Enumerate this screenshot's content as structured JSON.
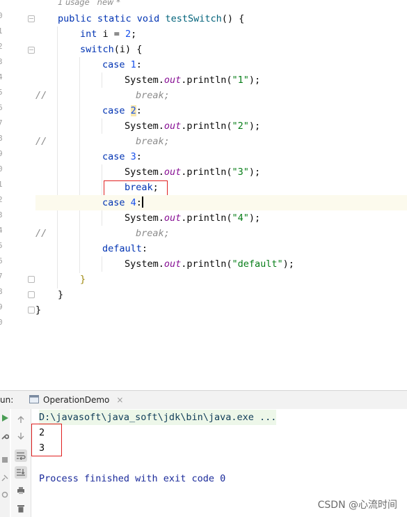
{
  "editor": {
    "meta_usage": "1 usage",
    "meta_new": "new *",
    "line_numbers": [
      "0",
      "1",
      "2",
      "3",
      "4",
      "5",
      "6",
      "7",
      "8",
      "9",
      "0",
      "1",
      "2",
      "3",
      "4",
      "5",
      "6",
      "7",
      "8",
      "9",
      "0"
    ],
    "code": {
      "l1_a": "public static void ",
      "l1_fn": "testSwitch",
      "l1_b": "() {",
      "l2_kw": "int",
      "l2_a": " i = ",
      "l2_num": "2",
      "l2_b": ";",
      "l3_kw": "switch",
      "l3_a": "(i) {",
      "case_kw": "case ",
      "colon": ":",
      "c1": "1",
      "c2": "2",
      "c3": "3",
      "c4": "4",
      "sys": "System.",
      "out": "out",
      "println": ".println(",
      "s1": "\"1\"",
      "s2": "\"2\"",
      "s3": "\"3\"",
      "s4": "\"4\"",
      "sdef": "\"default\"",
      "end": ");",
      "comment_slashes": "//",
      "comment_break": "break;",
      "break_kw": "break",
      "semicolon": ";",
      "default_kw": "default",
      "close_switch": "}",
      "close_method": "}",
      "close_class": "}"
    }
  },
  "run_bar": {
    "label": "un:",
    "tab_title": "OperationDemo",
    "tab_close": "×"
  },
  "console": {
    "command": "D:\\javasoft\\java_soft\\jdk\\bin\\java.exe ...",
    "output_lines": [
      "2",
      "3"
    ],
    "exit_message": "Process finished with exit code 0"
  },
  "watermark": "CSDN @心流时间",
  "icons": [
    "run-icon",
    "wrench-icon",
    "stop-icon",
    "scroll-up-icon",
    "scroll-down-icon",
    "soft-wrap-icon",
    "scroll-to-end-icon",
    "print-icon",
    "trash-icon",
    "pin-icon",
    "console-tab-icon"
  ]
}
